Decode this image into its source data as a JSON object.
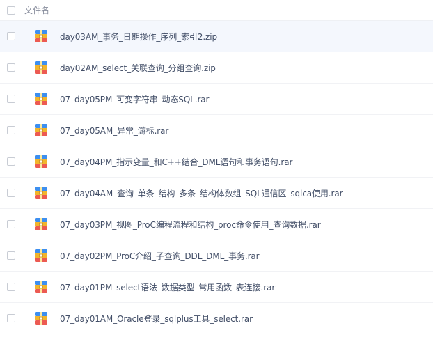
{
  "header": {
    "column_label": "文件名"
  },
  "files": [
    {
      "name": "day03AM_事务_日期操作_序列_索引2.zip",
      "icon": "archive-icon"
    },
    {
      "name": "day02AM_select_关联查询_分组查询.zip",
      "icon": "archive-icon"
    },
    {
      "name": "07_day05PM_可变字符串_动态SQL.rar",
      "icon": "archive-icon"
    },
    {
      "name": "07_day05AM_异常_游标.rar",
      "icon": "archive-icon"
    },
    {
      "name": "07_day04PM_指示变量_和C++结合_DML语句和事务语句.rar",
      "icon": "archive-icon"
    },
    {
      "name": "07_day04AM_查询_单条_结构_多条_结构体数组_SQL通信区_sqlca使用.rar",
      "icon": "archive-icon"
    },
    {
      "name": "07_day03PM_视图_ProC编程流程和结构_proc命令使用_查询数据.rar",
      "icon": "archive-icon"
    },
    {
      "name": "07_day02PM_ProC介绍_子查询_DDL_DML_事务.rar",
      "icon": "archive-icon"
    },
    {
      "name": "07_day01PM_select语法_数据类型_常用函数_表连接.rar",
      "icon": "archive-icon"
    },
    {
      "name": "07_day01AM_Oracle登录_sqlplus工具_select.rar",
      "icon": "archive-icon"
    }
  ],
  "colors": {
    "highlight_row": "#f4f7fd",
    "text": "#424e67",
    "header_text": "#878c9c"
  }
}
